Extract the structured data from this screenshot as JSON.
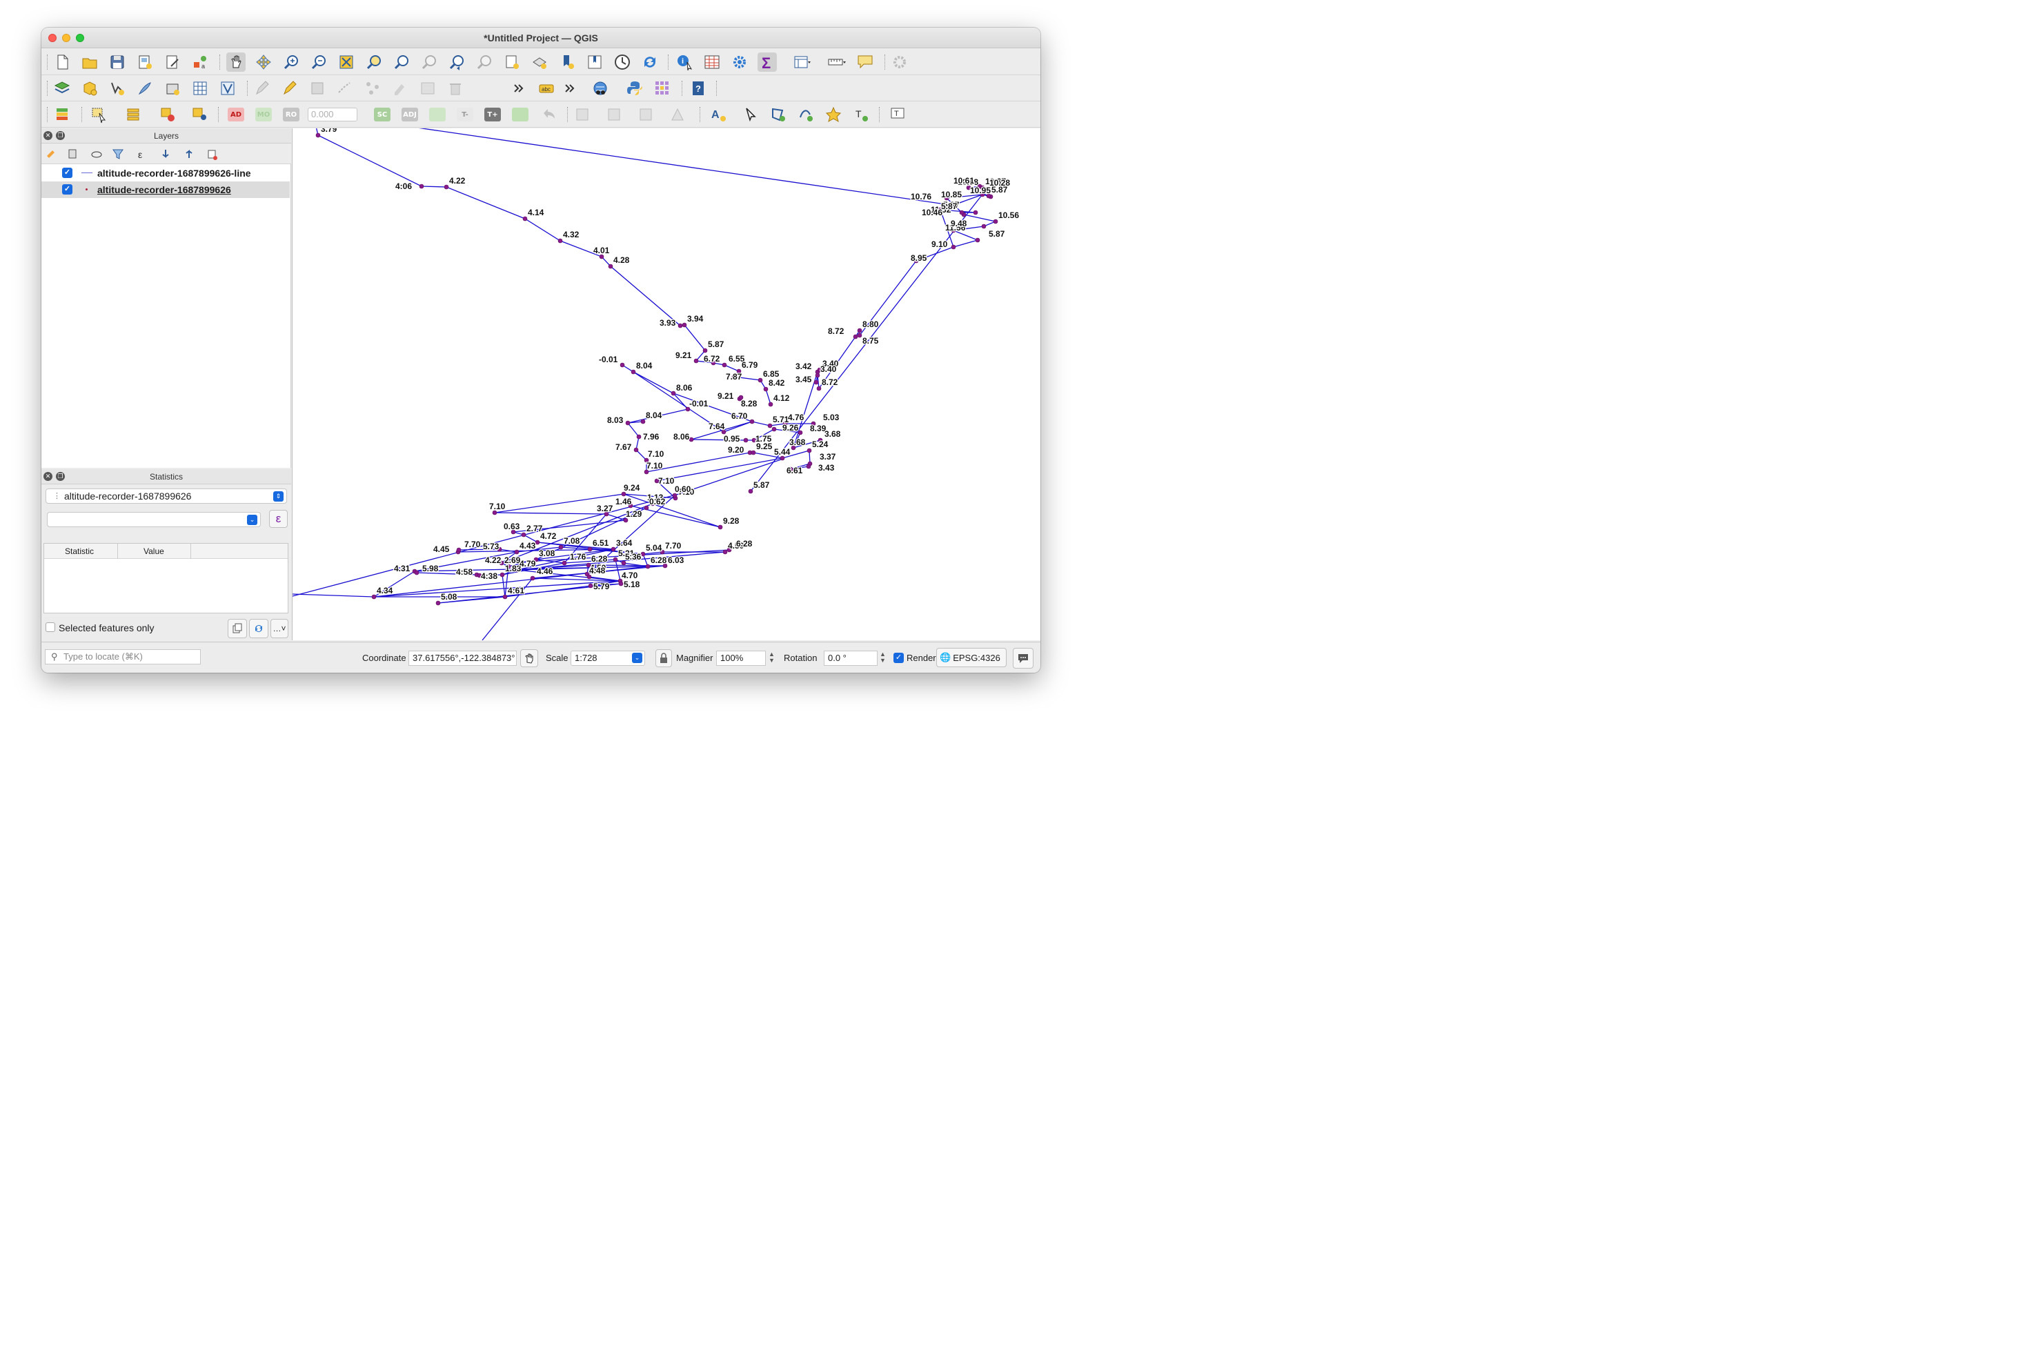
{
  "window": {
    "title": "*Untitled Project — QGIS"
  },
  "colors": {
    "track_line": "#1a0fd0",
    "point_fill": "#8a1a8c",
    "checkbox": "#1769e0",
    "accent_sigma": "#7a1fa2"
  },
  "toolbars": {
    "row3": {
      "rotation_value": "0.000",
      "btn_ad": "AD",
      "btn_mo": "MO",
      "btn_ro": "RO",
      "btn_sc": "SC",
      "btn_adj": "ADJ",
      "btn_tminus": "T-",
      "btn_tplus": "T+"
    }
  },
  "layers_panel": {
    "title": "Layers",
    "layers": [
      {
        "name": "altitude-recorder-1687899626-line",
        "checked": true,
        "type": "line"
      },
      {
        "name": "altitude-recorder-1687899626",
        "checked": true,
        "type": "point"
      }
    ]
  },
  "statistics_panel": {
    "title": "Statistics",
    "layer_select": "altitude-recorder-1687899626",
    "field_select": "",
    "columns": [
      "Statistic",
      "Value"
    ],
    "selected_only_label": "Selected features only"
  },
  "statusbar": {
    "locate_placeholder": "Type to locate (⌘K)",
    "coordinate_label": "Coordinate",
    "coordinate_value": "37.617556°,-122.384873°",
    "scale_label": "Scale",
    "scale_value": "1:728",
    "magnifier_label": "Magnifier",
    "magnifier_value": "100%",
    "rotation_label": "Rotation",
    "rotation_value": "0.0 °",
    "render_label": "Render",
    "crs": "EPSG:4326"
  },
  "map": {
    "labels": [
      "3.79",
      "4:06",
      "4.22",
      "4.14",
      "4.32",
      "4.01",
      "4.28",
      "3.93",
      "3.94",
      "5.87",
      "9.21",
      "6.72",
      "6.55",
      "6.79",
      "7.87",
      "6.85",
      "8.42",
      "9.21",
      "8.28",
      "4.12",
      "-0.01",
      "8.04",
      "8.06",
      "-0.01",
      "8.03",
      "8.04",
      "7.64",
      "6.70",
      "5.71",
      "4.76",
      "5.03",
      "8.06",
      "0.95",
      "1.75",
      "9.26",
      "8.39",
      "3.68",
      "3.68",
      "7.96",
      "7.67",
      "7.10",
      "7.10",
      "9.20",
      "9.25",
      "5.44",
      "5.24",
      "3.37",
      "6.61",
      "3.43",
      "7.10",
      "7.10",
      "3.42",
      "3.40",
      "3.45",
      "3.40",
      "8.72",
      "8.72",
      "8.80",
      "8.75",
      "8.95",
      "9.10",
      "5.87",
      "11.56",
      "9.48",
      "10.56",
      "5.87",
      "11.52",
      "5.87",
      "10.46",
      "10.76",
      "10.85",
      "10.95",
      "5.87",
      "10.98",
      "10.61",
      "10.67",
      "10.28",
      "5.87",
      "9.28",
      "9.24",
      "1.46",
      "1.13",
      "0.62",
      "0.60",
      "7.10",
      "3.27",
      "1.29",
      "0.63",
      "2.77",
      "4.72",
      "3.64",
      "4.45",
      "7.70",
      "5.73",
      "4.43",
      "7.08",
      "6.51",
      "5.04",
      "7.70",
      "4.50",
      "6.28",
      "4.22",
      "2.69",
      "3.08",
      "1.76",
      "5.21",
      "5.36",
      "6.28",
      "4.31",
      "5.98",
      "4:58",
      "4:38",
      "1.83",
      "4.79",
      "6.28",
      "6.03",
      "4.46",
      "4.50",
      "4.48",
      "4.70",
      "4.34",
      "4:61",
      "5.79",
      "5.18",
      "5.08",
      "4.90"
    ]
  }
}
